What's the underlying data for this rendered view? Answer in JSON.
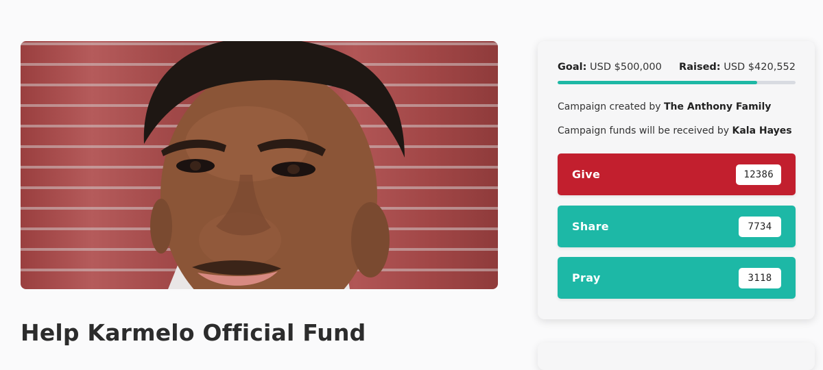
{
  "campaign": {
    "title": "Help Karmelo Official Fund",
    "photo_alt": "Portrait of a young man"
  },
  "funding": {
    "goal_label": "Goal:",
    "goal_value": "USD $500,000",
    "raised_label": "Raised:",
    "raised_value": "USD $420,552",
    "progress_fraction": 0.84
  },
  "info": {
    "created_prefix": "Campaign created by",
    "created_by": "The Anthony Family",
    "funds_prefix": "Campaign funds will be received by",
    "funds_recipient": "Kala Hayes"
  },
  "actions": {
    "give_label": "Give",
    "give_count": "12386",
    "share_label": "Share",
    "share_count": "7734",
    "pray_label": "Pray",
    "pray_count": "3118"
  },
  "colors": {
    "give": "#c21f2e",
    "share": "#1db8a6",
    "pray": "#1db8a6",
    "progress": "#1eb8a5"
  }
}
